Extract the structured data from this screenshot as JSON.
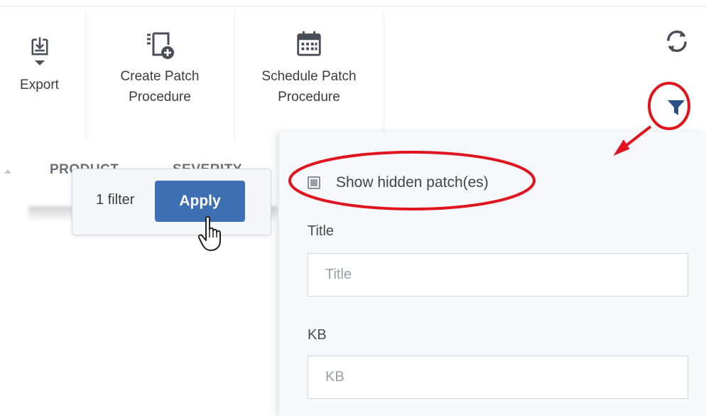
{
  "toolbar": {
    "export_label": "Export",
    "create_patch_label": "Create Patch\nProcedure",
    "schedule_patch_label": "Schedule Patch\nProcedure"
  },
  "columns": {
    "product": "PRODUCT",
    "severity": "SEVERITY"
  },
  "apply_popover": {
    "filter_count": "1 filter",
    "apply_label": "Apply"
  },
  "filter_panel": {
    "show_hidden_label": "Show hidden patch(es)",
    "show_hidden_checked": true,
    "title_label": "Title",
    "title_placeholder": "Title",
    "kb_label": "KB",
    "kb_placeholder": "KB"
  },
  "icons": {
    "export": "download-tray-icon",
    "create_patch": "create-procedure-icon",
    "schedule_patch": "calendar-icon",
    "refresh": "refresh-icon",
    "filter": "funnel-icon"
  },
  "colors": {
    "accent": "#3f6fb3",
    "annotation": "#e0141e",
    "icon": "#4a4f57"
  }
}
